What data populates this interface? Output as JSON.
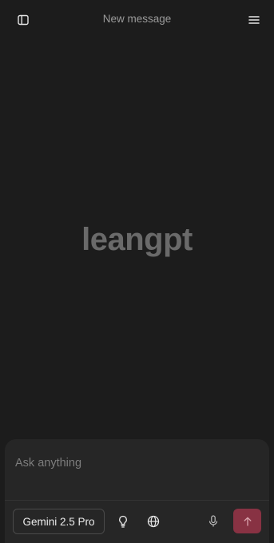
{
  "header": {
    "title": "New message",
    "left_icon": "sidebar-toggle-icon",
    "right_icon": "menu-icon"
  },
  "main": {
    "brand": "leangpt"
  },
  "composer": {
    "placeholder": "Ask anything",
    "model_label": "Gemini 2.5 Pro",
    "tools": [
      "lightbulb-icon",
      "globe-icon",
      "microphone-icon"
    ],
    "send_icon": "arrow-up-icon"
  },
  "colors": {
    "background": "#1c1c1c",
    "composer": "#262626",
    "send_button": "#883243",
    "brand_text": "#6a6a6a"
  }
}
